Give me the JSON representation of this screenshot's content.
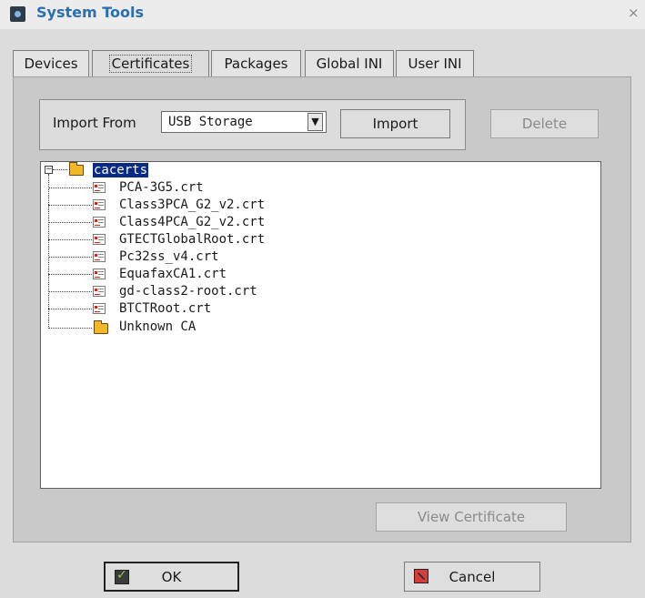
{
  "window": {
    "title": "System Tools",
    "close_glyph": "×",
    "icon": "app-settings-icon"
  },
  "tabs": [
    {
      "label": "Devices",
      "active": false
    },
    {
      "label": "Certificates",
      "active": true
    },
    {
      "label": "Packages",
      "active": false
    },
    {
      "label": "Global INI",
      "active": false
    },
    {
      "label": "User INI",
      "active": false
    }
  ],
  "import_group": {
    "label": "Import From",
    "source_value": "USB Storage",
    "import_button": "Import",
    "delete_button": "Delete"
  },
  "tree": {
    "root": "cacerts",
    "children": [
      "PCA-3G5.crt",
      "Class3PCA_G2_v2.crt",
      "Class4PCA_G2_v2.crt",
      "GTECTGlobalRoot.crt",
      "Pc32ss_v4.crt",
      "EquafaxCA1.crt",
      "gd-class2-root.crt",
      "BTCTRoot.crt",
      "Unknown CA"
    ]
  },
  "view_certificate_button": "View Certificate",
  "footer": {
    "ok_label": "OK",
    "cancel_label": "Cancel"
  },
  "colors": {
    "title": "#2a6fb0",
    "selection": "#0b2a86"
  }
}
